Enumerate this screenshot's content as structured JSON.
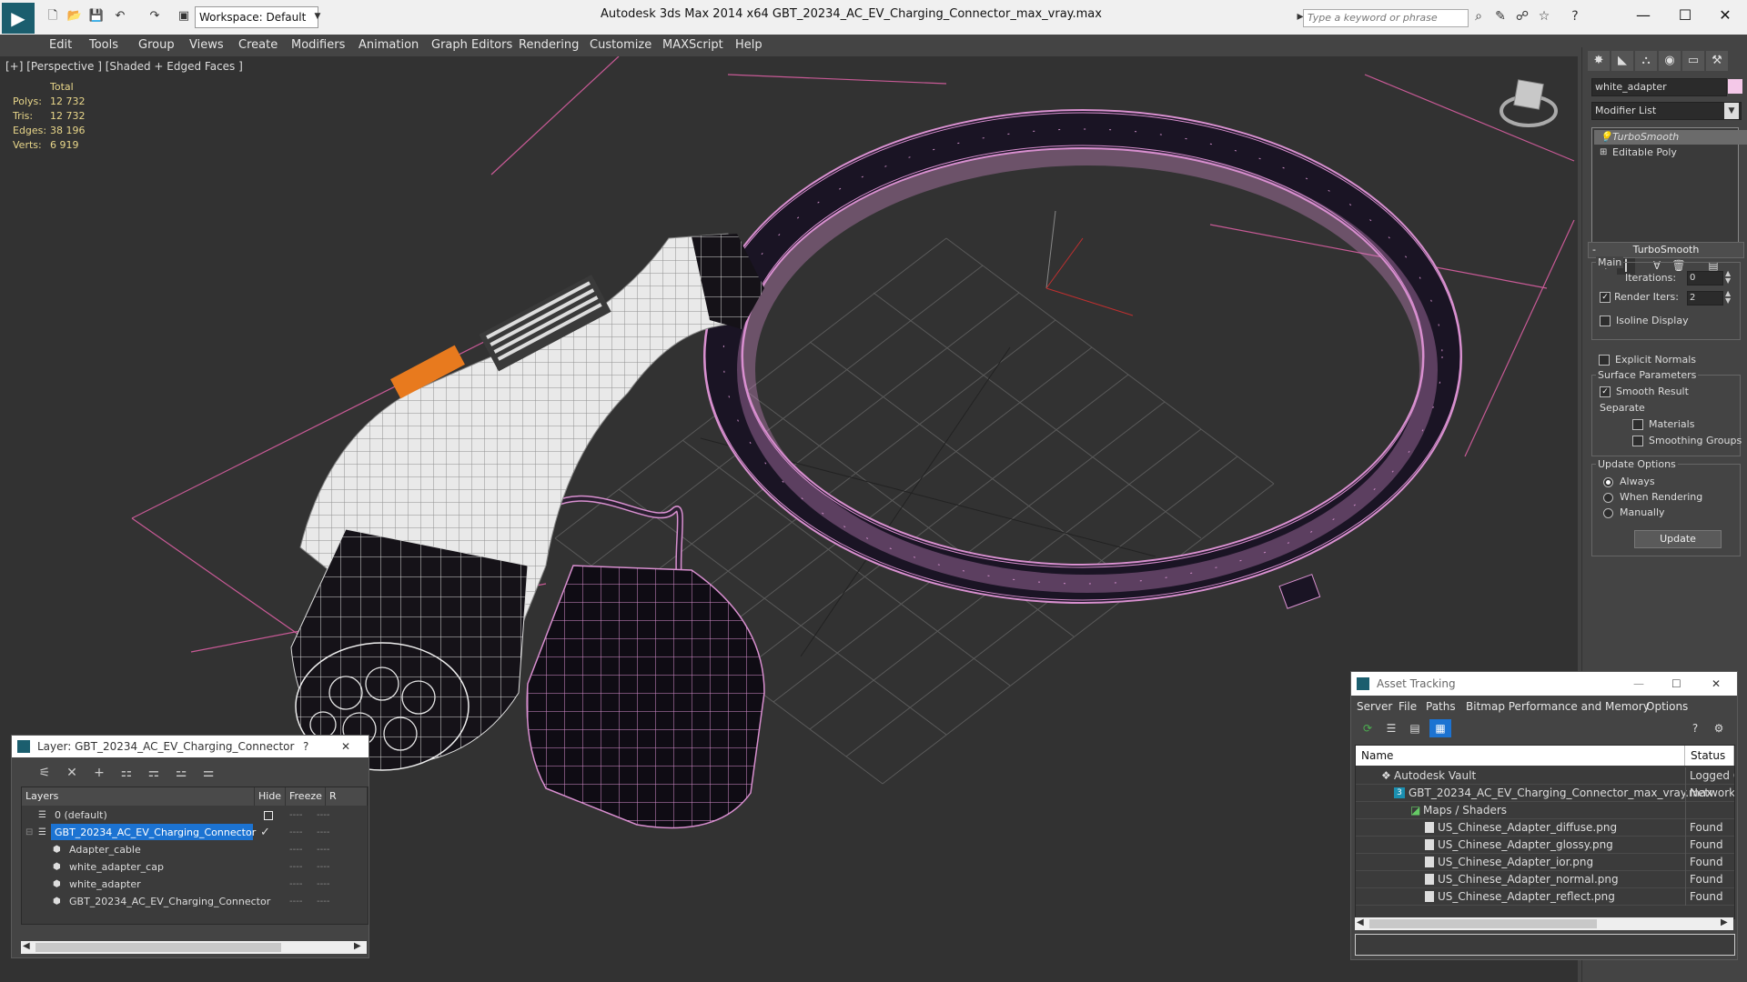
{
  "titlebar": {
    "app_title": "Autodesk 3ds Max  2014 x64      GBT_20234_AC_EV_Charging_Connector_max_vray.max",
    "workspace": "Workspace: Default",
    "search_placeholder": "Type a keyword or phrase",
    "minimize": "—",
    "maximize": "☐",
    "close": "✕"
  },
  "menu": [
    "Edit",
    "Tools",
    "Group",
    "Views",
    "Create",
    "Modifiers",
    "Animation",
    "Graph Editors",
    "Rendering",
    "Customize",
    "MAXScript",
    "Help"
  ],
  "viewport": {
    "label": "[+] [Perspective ] [Shaded + Edged Faces ]",
    "stats": {
      "header": "Total",
      "rows": [
        {
          "label": "Polys:",
          "value": "12 732"
        },
        {
          "label": "Tris:",
          "value": "12 732"
        },
        {
          "label": "Edges:",
          "value": "38 196"
        },
        {
          "label": "Verts:",
          "value": "6 919"
        }
      ]
    }
  },
  "command_panel": {
    "object_name": "white_adapter",
    "modifier_list": "Modifier List",
    "stack": [
      "TurboSmooth",
      "Editable Poly"
    ],
    "rollout_title": "TurboSmooth",
    "main_group": "Main",
    "iterations_label": "Iterations:",
    "iterations_value": "0",
    "render_iters_label": "Render Iters:",
    "render_iters_value": "2",
    "isoline_label": "Isoline Display",
    "explicit_normals_label": "Explicit Normals",
    "surface_group": "Surface Parameters",
    "smooth_result_label": "Smooth Result",
    "separate_label": "Separate",
    "materials_label": "Materials",
    "smoothing_groups_label": "Smoothing Groups",
    "update_group": "Update Options",
    "always_label": "Always",
    "when_rendering_label": "When Rendering",
    "manually_label": "Manually",
    "update_button": "Update"
  },
  "layer_dialog": {
    "title": "Layer: GBT_20234_AC_EV_Charging_Connector",
    "help": "?",
    "close": "✕",
    "columns": [
      "Layers",
      "Hide",
      "Freeze",
      "R"
    ],
    "rows": [
      {
        "name": "0 (default)",
        "indent": 1
      },
      {
        "name": "GBT_20234_AC_EV_Charging_Connector",
        "indent": 1,
        "selected": true
      },
      {
        "name": "Adapter_cable",
        "indent": 2
      },
      {
        "name": "white_adapter_cap",
        "indent": 2
      },
      {
        "name": "white_adapter",
        "indent": 2
      },
      {
        "name": "GBT_20234_AC_EV_Charging_Connector",
        "indent": 2
      }
    ],
    "dots": "----"
  },
  "asset_tracking": {
    "title": "Asset Tracking",
    "menu": [
      "Server",
      "File",
      "Paths",
      "Bitmap Performance and Memory",
      "Options"
    ],
    "columns": [
      "Name",
      "Status"
    ],
    "rows": [
      {
        "name": "Autodesk Vault",
        "status": "Logged O",
        "indent": 1
      },
      {
        "name": "GBT_20234_AC_EV_Charging_Connector_max_vray.max",
        "status": "Network",
        "indent": 2
      },
      {
        "name": "Maps / Shaders",
        "status": "",
        "indent": 3
      },
      {
        "name": "US_Chinese_Adapter_diffuse.png",
        "status": "Found",
        "indent": 4
      },
      {
        "name": "US_Chinese_Adapter_glossy.png",
        "status": "Found",
        "indent": 4
      },
      {
        "name": "US_Chinese_Adapter_ior.png",
        "status": "Found",
        "indent": 4
      },
      {
        "name": "US_Chinese_Adapter_normal.png",
        "status": "Found",
        "indent": 4
      },
      {
        "name": "US_Chinese_Adapter_reflect.png",
        "status": "Found",
        "indent": 4
      }
    ]
  },
  "colors": {
    "selection_blue": "#1c73d2",
    "wire_pink": "#e29ad8",
    "stat_yellow": "#e8d68a",
    "cable_dark": "#140f1f",
    "accent_orange": "#e87a1e"
  }
}
